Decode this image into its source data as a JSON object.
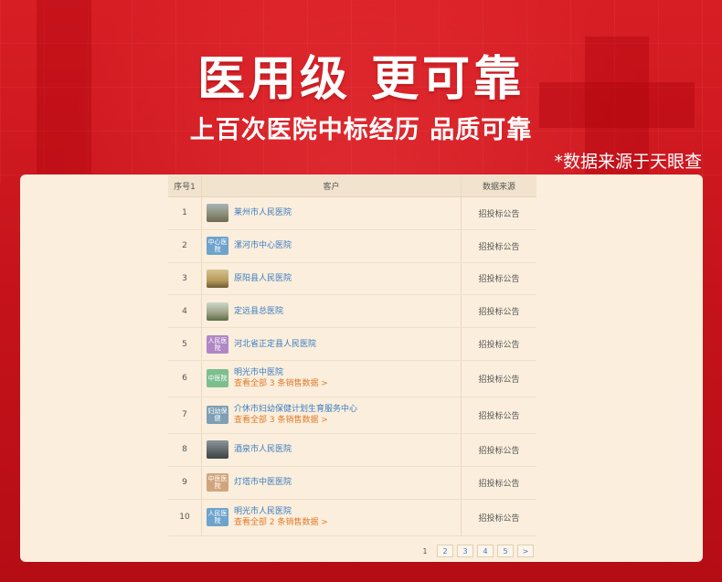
{
  "headline": "医用级  更可靠",
  "subline": "上百次医院中标经历 品质可靠",
  "source_note": "*数据来源于天眼查",
  "table": {
    "headers": {
      "no": "序号1",
      "client": "客户",
      "source": "数据来源"
    },
    "rows": [
      {
        "no": "1",
        "name": "莱州市人民医院",
        "more": "",
        "source": "招投标公告",
        "logo_text": ""
      },
      {
        "no": "2",
        "name": "漯河市中心医院",
        "more": "",
        "source": "招投标公告",
        "logo_text": "中心医院"
      },
      {
        "no": "3",
        "name": "原阳县人民医院",
        "more": "",
        "source": "招投标公告",
        "logo_text": ""
      },
      {
        "no": "4",
        "name": "定远县总医院",
        "more": "",
        "source": "招投标公告",
        "logo_text": ""
      },
      {
        "no": "5",
        "name": "河北省正定县人民医院",
        "more": "",
        "source": "招投标公告",
        "logo_text": "人民医院"
      },
      {
        "no": "6",
        "name": "明光市中医院",
        "more": "查看全部 3 条销售数据 >",
        "source": "招投标公告",
        "logo_text": "中医院"
      },
      {
        "no": "7",
        "name": "介休市妇幼保健计划生育服务中心",
        "more": "查看全部 3 条销售数据 >",
        "source": "招投标公告",
        "logo_text": "妇幼保健"
      },
      {
        "no": "8",
        "name": "酒泉市人民医院",
        "more": "",
        "source": "招投标公告",
        "logo_text": ""
      },
      {
        "no": "9",
        "name": "灯塔市中医医院",
        "more": "",
        "source": "招投标公告",
        "logo_text": "中医医院"
      },
      {
        "no": "10",
        "name": "明光市人民医院",
        "more": "查看全部 2 条销售数据 >",
        "source": "招投标公告",
        "logo_text": "人民医院"
      }
    ]
  },
  "pagination": {
    "pages": [
      "1",
      "2",
      "3",
      "4",
      "5"
    ],
    "next": ">"
  },
  "colors": {
    "brand_red": "#c8111a",
    "panel": "#fbeedc",
    "link_blue": "#3a7cc0",
    "more_orange": "#e07b2c"
  }
}
